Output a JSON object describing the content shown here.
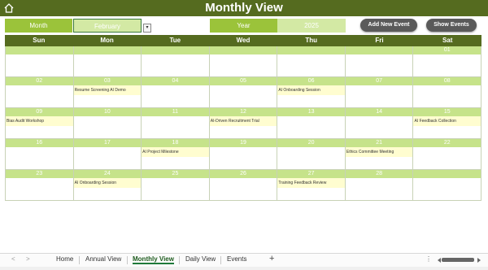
{
  "header": {
    "title": "Monthly View"
  },
  "controls": {
    "month_label": "Month",
    "month_value": "February",
    "year_label": "Year",
    "year_value": "2025",
    "add_event_label": "Add New Event",
    "show_events_label": "Show Events"
  },
  "calendar": {
    "weekdays": [
      "Sun",
      "Mon",
      "Tue",
      "Wed",
      "Thu",
      "Fri",
      "Sat"
    ],
    "weeks": [
      [
        {
          "day": "",
          "event": ""
        },
        {
          "day": "",
          "event": ""
        },
        {
          "day": "",
          "event": ""
        },
        {
          "day": "",
          "event": ""
        },
        {
          "day": "",
          "event": ""
        },
        {
          "day": "",
          "event": ""
        },
        {
          "day": "01",
          "event": ""
        }
      ],
      [
        {
          "day": "02",
          "event": ""
        },
        {
          "day": "03",
          "event": "Resume Screening AI Demo"
        },
        {
          "day": "04",
          "event": ""
        },
        {
          "day": "05",
          "event": ""
        },
        {
          "day": "06",
          "event": "AI Onboarding Session"
        },
        {
          "day": "07",
          "event": ""
        },
        {
          "day": "08",
          "event": ""
        }
      ],
      [
        {
          "day": "09",
          "event": "Bias Audit Workshop"
        },
        {
          "day": "10",
          "event": ""
        },
        {
          "day": "11",
          "event": ""
        },
        {
          "day": "12",
          "event": "AI-Driven Recruitment Trial"
        },
        {
          "day": "13",
          "event": ""
        },
        {
          "day": "14",
          "event": ""
        },
        {
          "day": "15",
          "event": "AI Feedback Collection"
        }
      ],
      [
        {
          "day": "16",
          "event": ""
        },
        {
          "day": "17",
          "event": ""
        },
        {
          "day": "18",
          "event": "AI Project Milestone"
        },
        {
          "day": "19",
          "event": ""
        },
        {
          "day": "20",
          "event": ""
        },
        {
          "day": "21",
          "event": "Ethics Committee Meeting"
        },
        {
          "day": "22",
          "event": ""
        }
      ],
      [
        {
          "day": "23",
          "event": ""
        },
        {
          "day": "24",
          "event": "AI Onboarding Session"
        },
        {
          "day": "25",
          "event": ""
        },
        {
          "day": "26",
          "event": ""
        },
        {
          "day": "27",
          "event": "Training Feedback Review"
        },
        {
          "day": "28",
          "event": ""
        },
        {
          "day": "",
          "event": ""
        }
      ]
    ]
  },
  "sheet_tabs": {
    "tabs": [
      "Home",
      "Annual View",
      "Monthly View",
      "Daily View",
      "Events"
    ],
    "active": "Monthly View",
    "add_label": "+",
    "prev_label": "<",
    "next_label": ">",
    "menu_label": "⋮"
  },
  "colors": {
    "title_bar": "#556b1f",
    "label_green": "#9bc33a",
    "value_green": "#d3e9a4",
    "day_number_bar": "#c6e38a",
    "event_bg": "#fffdd0",
    "button": "#5a5a5a"
  }
}
